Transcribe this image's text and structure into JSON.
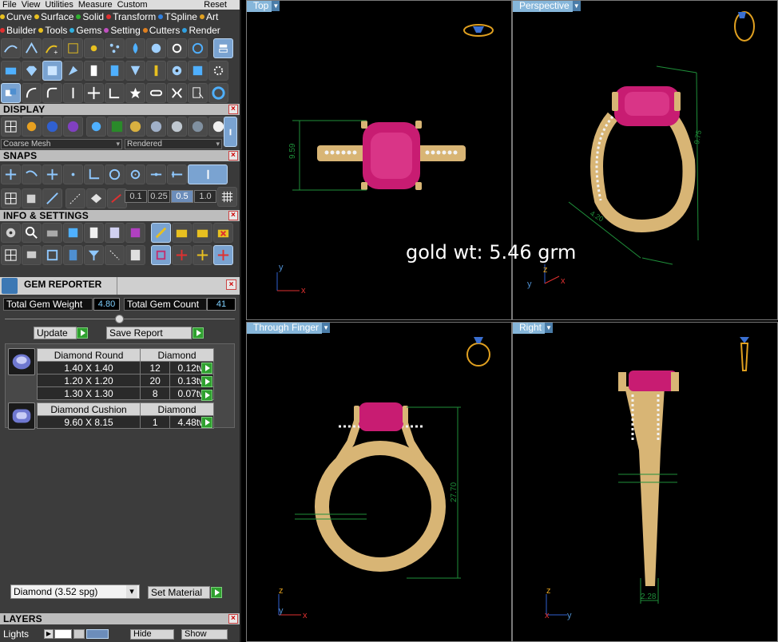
{
  "menu": {
    "items": [
      "File",
      "View",
      "Utilities",
      "Measure",
      "Custom"
    ],
    "reset": "Reset"
  },
  "plugins_row1": [
    {
      "label": "Curve",
      "color": "#e8c020"
    },
    {
      "label": "Surface",
      "color": "#e8c020"
    },
    {
      "label": "Solid",
      "color": "#30b030"
    },
    {
      "label": "Transform",
      "color": "#e03030"
    },
    {
      "label": "TSpline",
      "color": "#3080e0"
    },
    {
      "label": "Art",
      "color": "#e0a020"
    }
  ],
  "plugins_row2": [
    {
      "label": "Builder",
      "color": "#e03030"
    },
    {
      "label": "Tools",
      "color": "#e8c020"
    },
    {
      "label": "Gems",
      "color": "#30b0e0"
    },
    {
      "label": "Setting",
      "color": "#c050c0"
    },
    {
      "label": "Cutters",
      "color": "#e08020"
    },
    {
      "label": "Render",
      "color": "#30a0e0"
    }
  ],
  "sections": {
    "display": "DISPLAY",
    "snaps": "SNAPS",
    "info": "INFO & SETTINGS",
    "layers": "LAYERS"
  },
  "display": {
    "mesh_mode": "Coarse Mesh",
    "render_mode": "Rendered"
  },
  "snaps": {
    "values": [
      "0.1",
      "0.25",
      "0.5",
      "1.0"
    ],
    "selected": "0.5"
  },
  "gem_reporter": {
    "title": "GEM REPORTER",
    "total_weight_label": "Total Gem Weight",
    "total_weight": "4.80",
    "total_count_label": "Total Gem Count",
    "total_count": "41",
    "update": "Update",
    "save_report": "Save Report",
    "groups": [
      {
        "shape": "Diamond Round",
        "material": "Diamond",
        "rows": [
          {
            "size": "1.40 X 1.40",
            "count": "12",
            "weight": "0.12tw"
          },
          {
            "size": "1.20 X 1.20",
            "count": "20",
            "weight": "0.13tw"
          },
          {
            "size": "1.30 X 1.30",
            "count": "8",
            "weight": "0.07tw"
          }
        ]
      },
      {
        "shape": "Diamond Cushion",
        "material": "Diamond",
        "rows": [
          {
            "size": "9.60 X 8.15",
            "count": "1",
            "weight": "4.48tw"
          }
        ]
      }
    ],
    "material_select": "Diamond     (3.52 spg)",
    "set_material": "Set Material"
  },
  "layers": {
    "lights": "Lights",
    "hide": "Hide",
    "show": "Show"
  },
  "viewports": {
    "top": "Top",
    "perspective": "Perspective",
    "through_finger": "Through Finger",
    "right": "Right"
  },
  "dimensions": {
    "top_height": "9.59",
    "persp_height": "9.75",
    "persp_width": "4.20",
    "finger_height": "27.70",
    "right_width": "2.28"
  },
  "overlay": {
    "gold_weight": "gold wt: 5.46 grm"
  },
  "axis_labels": {
    "x": "x",
    "y": "y",
    "z": "z"
  },
  "colors": {
    "gold": "#d9b77a",
    "gem": "#d3207a",
    "dim_line": "#1f8f3a",
    "tab": "#86b6da"
  }
}
